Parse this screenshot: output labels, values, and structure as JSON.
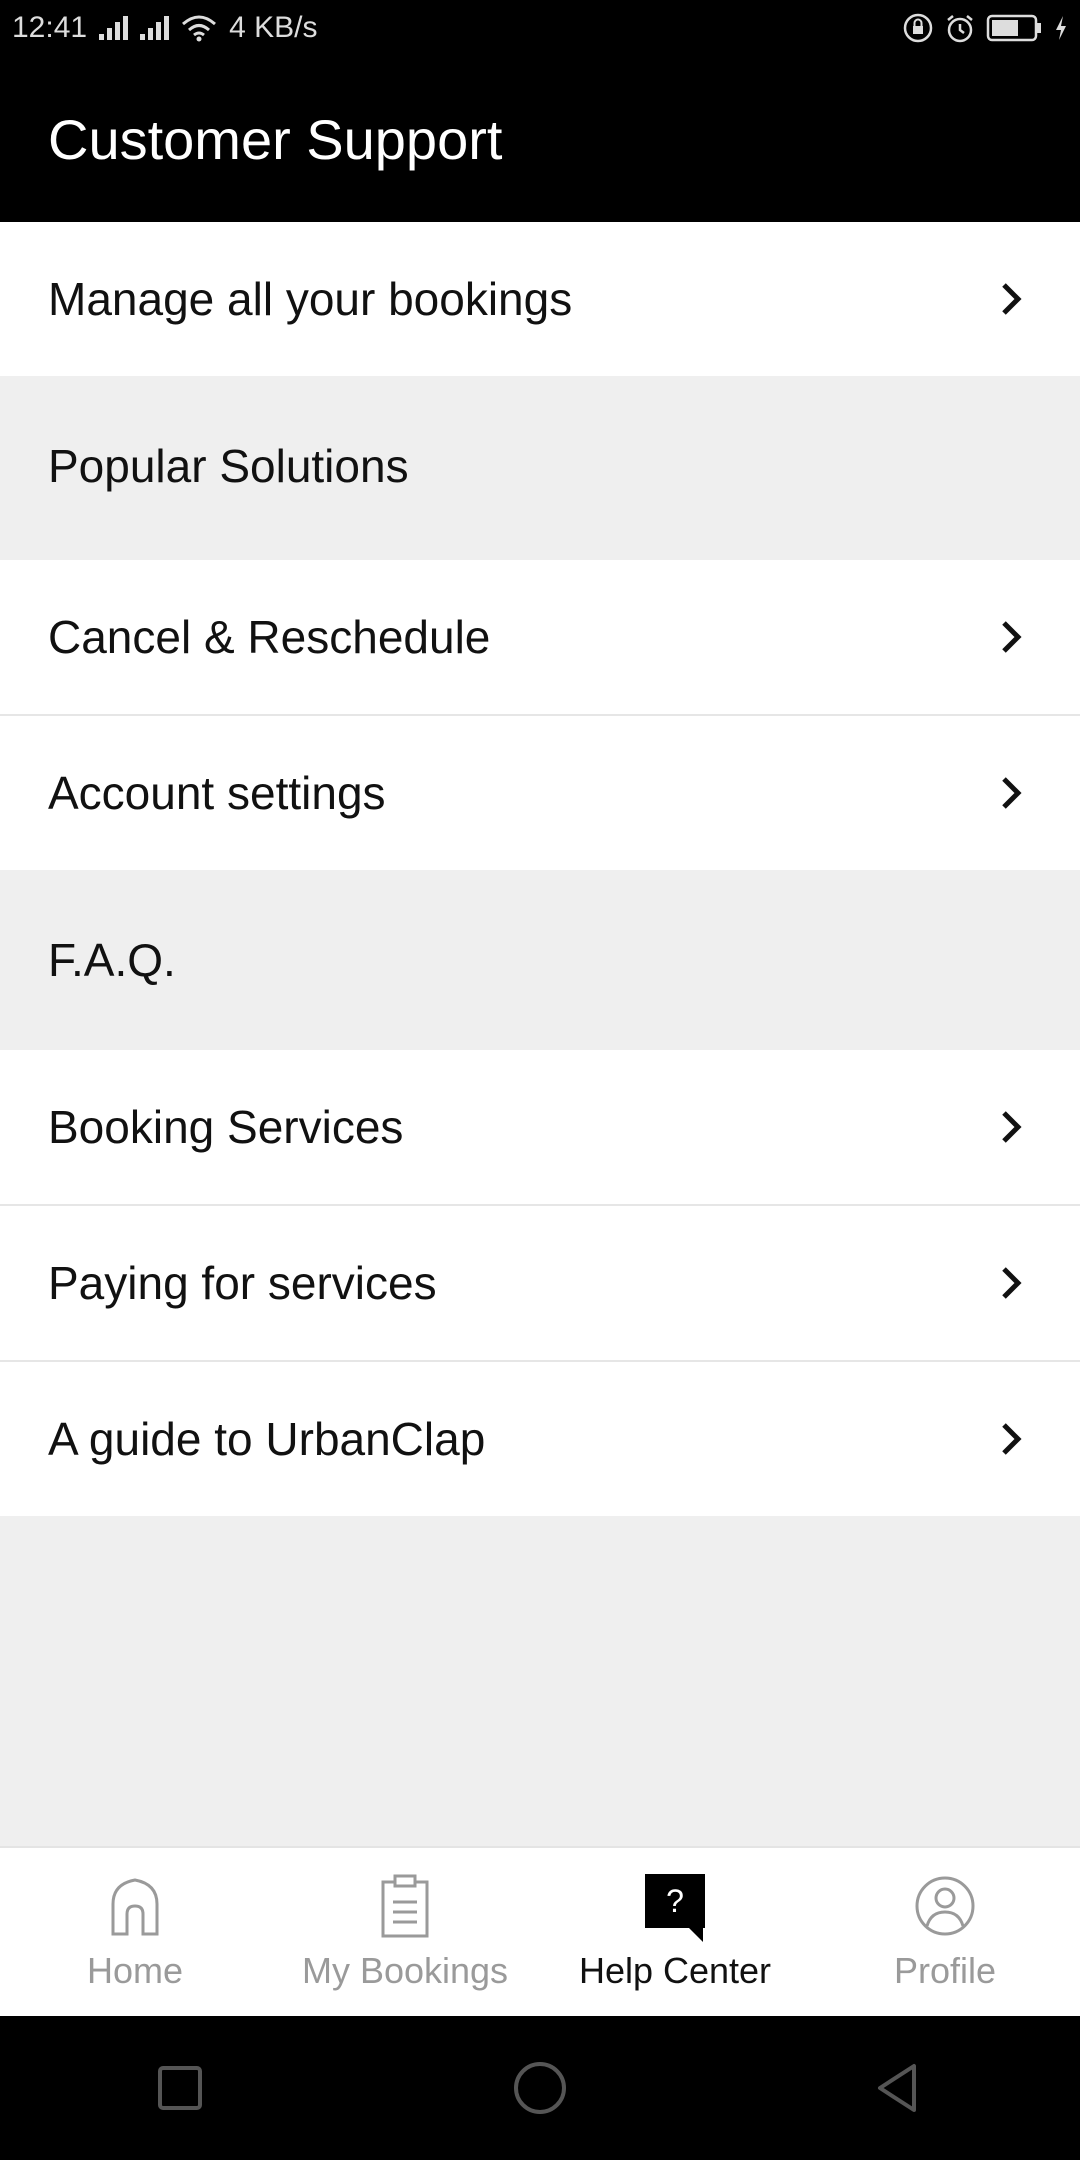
{
  "status_bar": {
    "time": "12:41",
    "network_speed": "4 KB/s",
    "icons": [
      "signal-icon",
      "signal-icon",
      "wifi-icon",
      "rotation-lock-icon",
      "alarm-icon",
      "battery-icon",
      "charging-icon"
    ]
  },
  "header": {
    "title": "Customer Support"
  },
  "rows": {
    "manage_bookings": "Manage all your bookings",
    "popular_solutions": "Popular Solutions",
    "cancel_reschedule": "Cancel & Reschedule",
    "account_settings": "Account settings",
    "faq": "F.A.Q.",
    "booking_services": "Booking Services",
    "paying_for_services": "Paying for services",
    "guide_urbanclap": "A guide to UrbanClap"
  },
  "tabs": [
    {
      "label": "Home",
      "icon": "home-icon",
      "active": false
    },
    {
      "label": "My Bookings",
      "icon": "bookings-icon",
      "active": false
    },
    {
      "label": "Help Center",
      "icon": "help-center-icon",
      "active": true
    },
    {
      "label": "Profile",
      "icon": "profile-icon",
      "active": false
    }
  ],
  "help_icon_glyph": "?",
  "colors": {
    "header_bg": "#000000",
    "section_bg": "#efefef",
    "active_tab": "#111111",
    "inactive_tab": "#9a9a9a"
  }
}
